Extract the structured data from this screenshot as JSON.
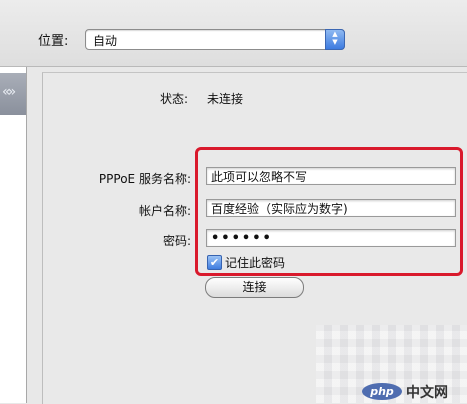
{
  "toolbar": {
    "location_label": "位置:",
    "location_value": "自动"
  },
  "status": {
    "label": "状态:",
    "value": "未连接"
  },
  "form": {
    "service_label": "PPPoE 服务名称:",
    "service_value": "此项可以忽略不写",
    "account_label": "帐户名称:",
    "account_value": "百度经验（实际应为数字)",
    "password_label": "密码:",
    "password_value": "••••••",
    "remember_label": "记住此密码",
    "remember_checked": true
  },
  "actions": {
    "connect_label": "连接"
  },
  "watermark": {
    "logo": "php",
    "text": "中文网"
  },
  "colors": {
    "highlight": "#d9192c",
    "accent": "#3d7be0"
  }
}
